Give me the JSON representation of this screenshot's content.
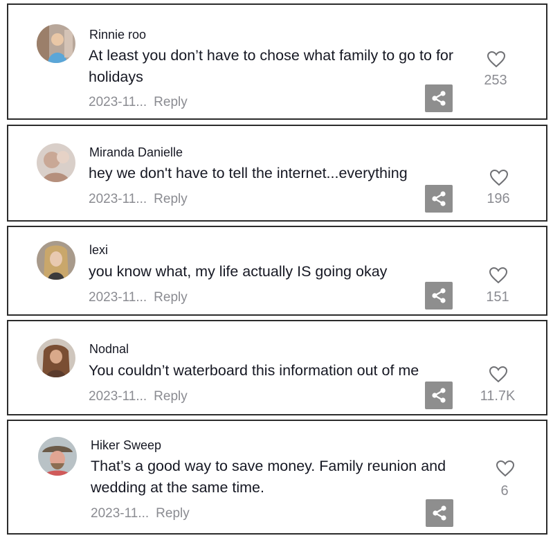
{
  "comments": [
    {
      "username": "Rinnie roo",
      "text": "At least you don’t have to chose what family to go to for holidays",
      "date": "2023-11...",
      "reply": "Reply",
      "likes": "253",
      "avatar_icon": "profile-photo-icon"
    },
    {
      "username": "Miranda Danielle",
      "text": "hey we don't have to tell the internet...everything",
      "date": "2023-11...",
      "reply": "Reply",
      "likes": "196",
      "avatar_icon": "profile-photo-icon"
    },
    {
      "username": "lexi",
      "text": "you know what, my life actually IS going okay",
      "date": "2023-11...",
      "reply": "Reply",
      "likes": "151",
      "avatar_icon": "profile-photo-icon"
    },
    {
      "username": "Nodnal",
      "text": "You couldn’t waterboard this information out of me",
      "date": "2023-11...",
      "reply": "Reply",
      "likes": "11.7K",
      "avatar_icon": "profile-photo-icon"
    },
    {
      "username": "Hiker Sweep",
      "text": "That’s a good way to save money. Family reunion and wedding at the same time.",
      "date": "2023-11...",
      "reply": "Reply",
      "likes": "6",
      "avatar_icon": "profile-photo-icon"
    }
  ],
  "colors": {
    "text": "#161823",
    "muted": "#8a8b91",
    "share_bg": "#8e8e8e",
    "border": "#2b2b2b"
  },
  "icons": [
    "heart-icon",
    "share-icon"
  ]
}
